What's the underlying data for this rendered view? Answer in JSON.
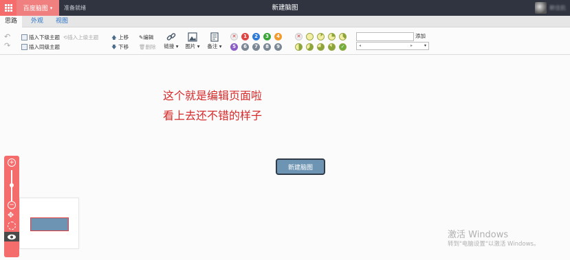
{
  "topbar": {
    "brand": "百度脑图",
    "status": "准备就绪",
    "doc_title": "新建脑图",
    "username": "赖佳航"
  },
  "tabs": [
    {
      "label": "思路",
      "active": true
    },
    {
      "label": "外观",
      "active": false
    },
    {
      "label": "视图",
      "active": false
    }
  ],
  "toolbar": {
    "insert_child": "插入下级主题",
    "insert_parent": "插入上级主题",
    "insert_sibling": "插入同级主题",
    "move_up": "上移",
    "move_down": "下移",
    "edit": "编辑",
    "delete": "删除",
    "link": "链接",
    "image": "图片",
    "note": "备注",
    "priorities": [
      "1",
      "2",
      "3",
      "4",
      "5",
      "6",
      "7",
      "8",
      "9"
    ],
    "resource_add": "添加",
    "resource_value": ""
  },
  "canvas": {
    "annotation_line1": "这个就是编辑页面啦",
    "annotation_line2": "看上去还不错的样子",
    "root_node": "新建脑图"
  },
  "watermark": {
    "line1": "激活 Windows",
    "line2": "转到\"电脑设置\"以激活 Windows。"
  },
  "colors": {
    "accent": "#f56c6c",
    "topbar": "#2f3440",
    "node_fill": "#6d95b3",
    "annotation": "#d42a2a"
  }
}
